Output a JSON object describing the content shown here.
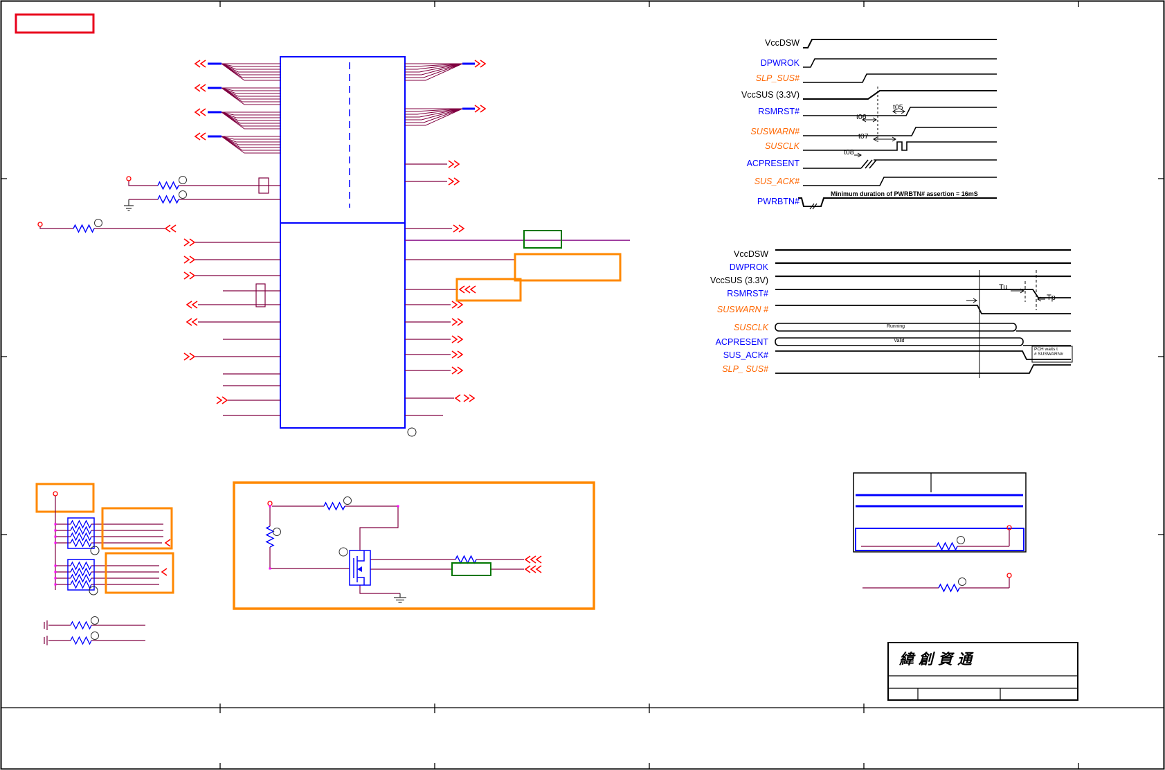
{
  "palette": {
    "wire_maroon": "#800040",
    "wire_purple": "#800080",
    "component_blue": "#0000ff",
    "connector_red": "#ff0000",
    "box_orange": "#ff8800",
    "box_green": "#007700",
    "junction_magenta": "#ff00ff",
    "label_black": "#000000",
    "label_blue": "#0000ff",
    "label_orange": "#ff6600"
  },
  "timing_diagram_1": {
    "signals": [
      {
        "name": "VccDSW",
        "color": "#000000",
        "italic": false
      },
      {
        "name": "DPWROK",
        "color": "#0000ff",
        "italic": false
      },
      {
        "name": "SLP_SUS#",
        "color": "#ff6600",
        "italic": true
      },
      {
        "name": "VccSUS (3.3V)",
        "color": "#000000",
        "italic": false
      },
      {
        "name": "RSMRST#",
        "color": "#0000ff",
        "italic": false
      },
      {
        "name": "SUSWARN#",
        "color": "#ff6600",
        "italic": true
      },
      {
        "name": "SUSCLK",
        "color": "#ff6600",
        "italic": true
      },
      {
        "name": "ACPRESENT",
        "color": "#0000ff",
        "italic": false
      },
      {
        "name": "SUS_ACK#",
        "color": "#ff6600",
        "italic": true
      },
      {
        "name": "PWRBTN#",
        "color": "#0000ff",
        "italic": false
      }
    ],
    "annotations": {
      "t05": "t05",
      "t06": "t06",
      "t07": "t07",
      "t08": "t08",
      "pwrbtn_note": "Minimum duration of PWRBTN#  assertion = 16mS"
    }
  },
  "timing_diagram_2": {
    "signals": [
      {
        "name": "VccDSW",
        "color": "#000000",
        "italic": false
      },
      {
        "name": "DWPROK",
        "color": "#0000ff",
        "italic": false
      },
      {
        "name": "VccSUS (3.3V)",
        "color": "#000000",
        "italic": false
      },
      {
        "name": "RSMRST#",
        "color": "#0000ff",
        "italic": false
      },
      {
        "name": "SUSWARN #",
        "color": "#ff6600",
        "italic": true
      },
      {
        "name": "SUSCLK",
        "color": "#ff6600",
        "italic": true
      },
      {
        "name": "ACPRESENT",
        "color": "#0000ff",
        "italic": false
      },
      {
        "name": "SUS_ACK#",
        "color": "#0000ff",
        "italic": false
      },
      {
        "name": "SLP_ SUS#",
        "color": "#ff6600",
        "italic": true
      }
    ],
    "annotations": {
      "tu": "Tu",
      "tp": "Tp",
      "susclk_state": "Running",
      "acpresent_state": "Valid",
      "pch_note_line1": "PCH waits t",
      "pch_note_line2": "# SUSWARN#"
    }
  },
  "title_block": {
    "company": "緯創資通"
  }
}
